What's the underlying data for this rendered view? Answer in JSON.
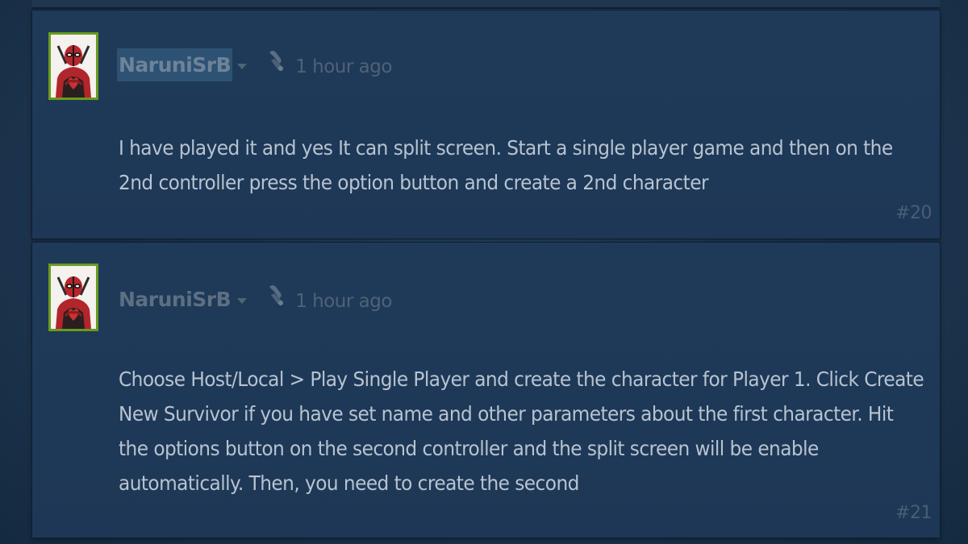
{
  "comments": [
    {
      "author": "NaruniSrB",
      "timestamp": "1 hour ago",
      "text": "I have played it and yes It can split screen. Start a single player game and then on the 2nd controller press the option button and create a 2nd character",
      "number": "#20",
      "avatar_icon": "deadpool-avatar",
      "author_selected": true
    },
    {
      "author": "NaruniSrB",
      "timestamp": "1 hour ago",
      "text": "Choose Host/Local > Play Single Player and create the character for Player 1. Click Create New Survivor if you have set name and other parameters about the first character. Hit the options button on the second controller and the split screen will be enable automatically. Then, you need to create the second",
      "number": "#21",
      "avatar_icon": "deadpool-avatar",
      "author_selected": false
    }
  ],
  "colors": {
    "background": "#1d3650",
    "panel": "#1f3a59",
    "text": "#b7c3cf",
    "author": "#5d6f82",
    "avatar_border": "#6a9b1e",
    "selection": "#2e5273"
  }
}
